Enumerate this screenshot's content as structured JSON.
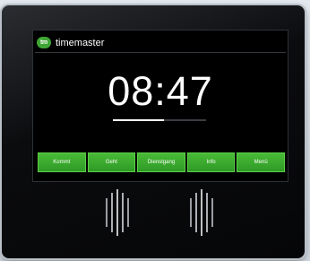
{
  "brand": {
    "logo_text": "tm",
    "name": "timemaster"
  },
  "clock": {
    "time": "08:47",
    "underline_progress": 0.55
  },
  "buttons": [
    {
      "label": "Kommt"
    },
    {
      "label": "Geht"
    },
    {
      "label": "Dienstgang"
    },
    {
      "label": "Info"
    },
    {
      "label": "Menü"
    }
  ],
  "colors": {
    "accent_green": "#3fa635",
    "button_green": "#3aa82e",
    "screen_bg": "#000000",
    "device_body": "#0b0c0e"
  },
  "icons": {
    "reader_left": "rfid-reader-icon",
    "reader_right": "rfid-reader-icon"
  }
}
